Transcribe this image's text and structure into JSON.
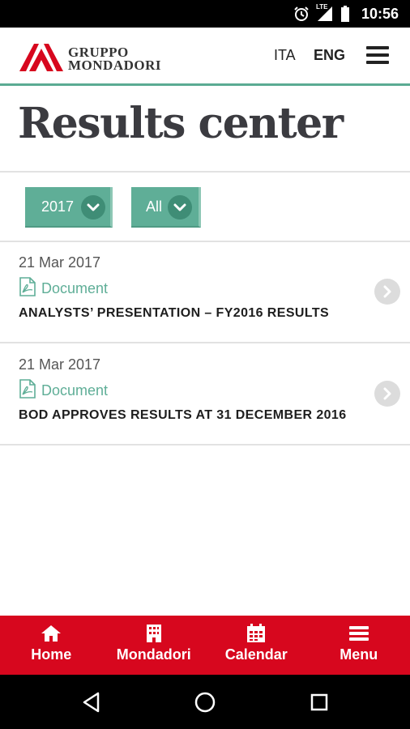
{
  "status_bar": {
    "network": "LTE",
    "time": "10:56",
    "icons": [
      "alarm-icon",
      "signal-icon",
      "battery-icon"
    ]
  },
  "header": {
    "logo": {
      "line1": "GRUPPO",
      "line2": "MONDADORI"
    },
    "languages": [
      "ITA",
      "ENG"
    ],
    "active_language": "ENG",
    "menu_icon": "hamburger-icon"
  },
  "page": {
    "title": "Results center"
  },
  "filters": {
    "year": "2017",
    "type": "All",
    "chevron_icon": "chevron-down-icon"
  },
  "results": [
    {
      "date": "21 Mar 2017",
      "doc_label": "Document",
      "title": "ANALYSTS’ PRESENTATION – FY2016 RESULTS"
    },
    {
      "date": "21 Mar 2017",
      "doc_label": "Document",
      "title": "BOD APPROVES RESULTS AT 31 DECEMBER 2016"
    }
  ],
  "bottom_nav": {
    "items": [
      {
        "label": "Home",
        "icon": "home-icon"
      },
      {
        "label": "Mondadori",
        "icon": "building-icon"
      },
      {
        "label": "Calendar",
        "icon": "calendar-icon"
      },
      {
        "label": "Menu",
        "icon": "menu-icon"
      }
    ]
  },
  "system_nav": {
    "icons": [
      "back-icon",
      "home-circle-icon",
      "recents-icon"
    ]
  },
  "colors": {
    "accent_green": "#5fae97",
    "brand_red": "#d7071e",
    "title_text": "#3b3b40"
  }
}
